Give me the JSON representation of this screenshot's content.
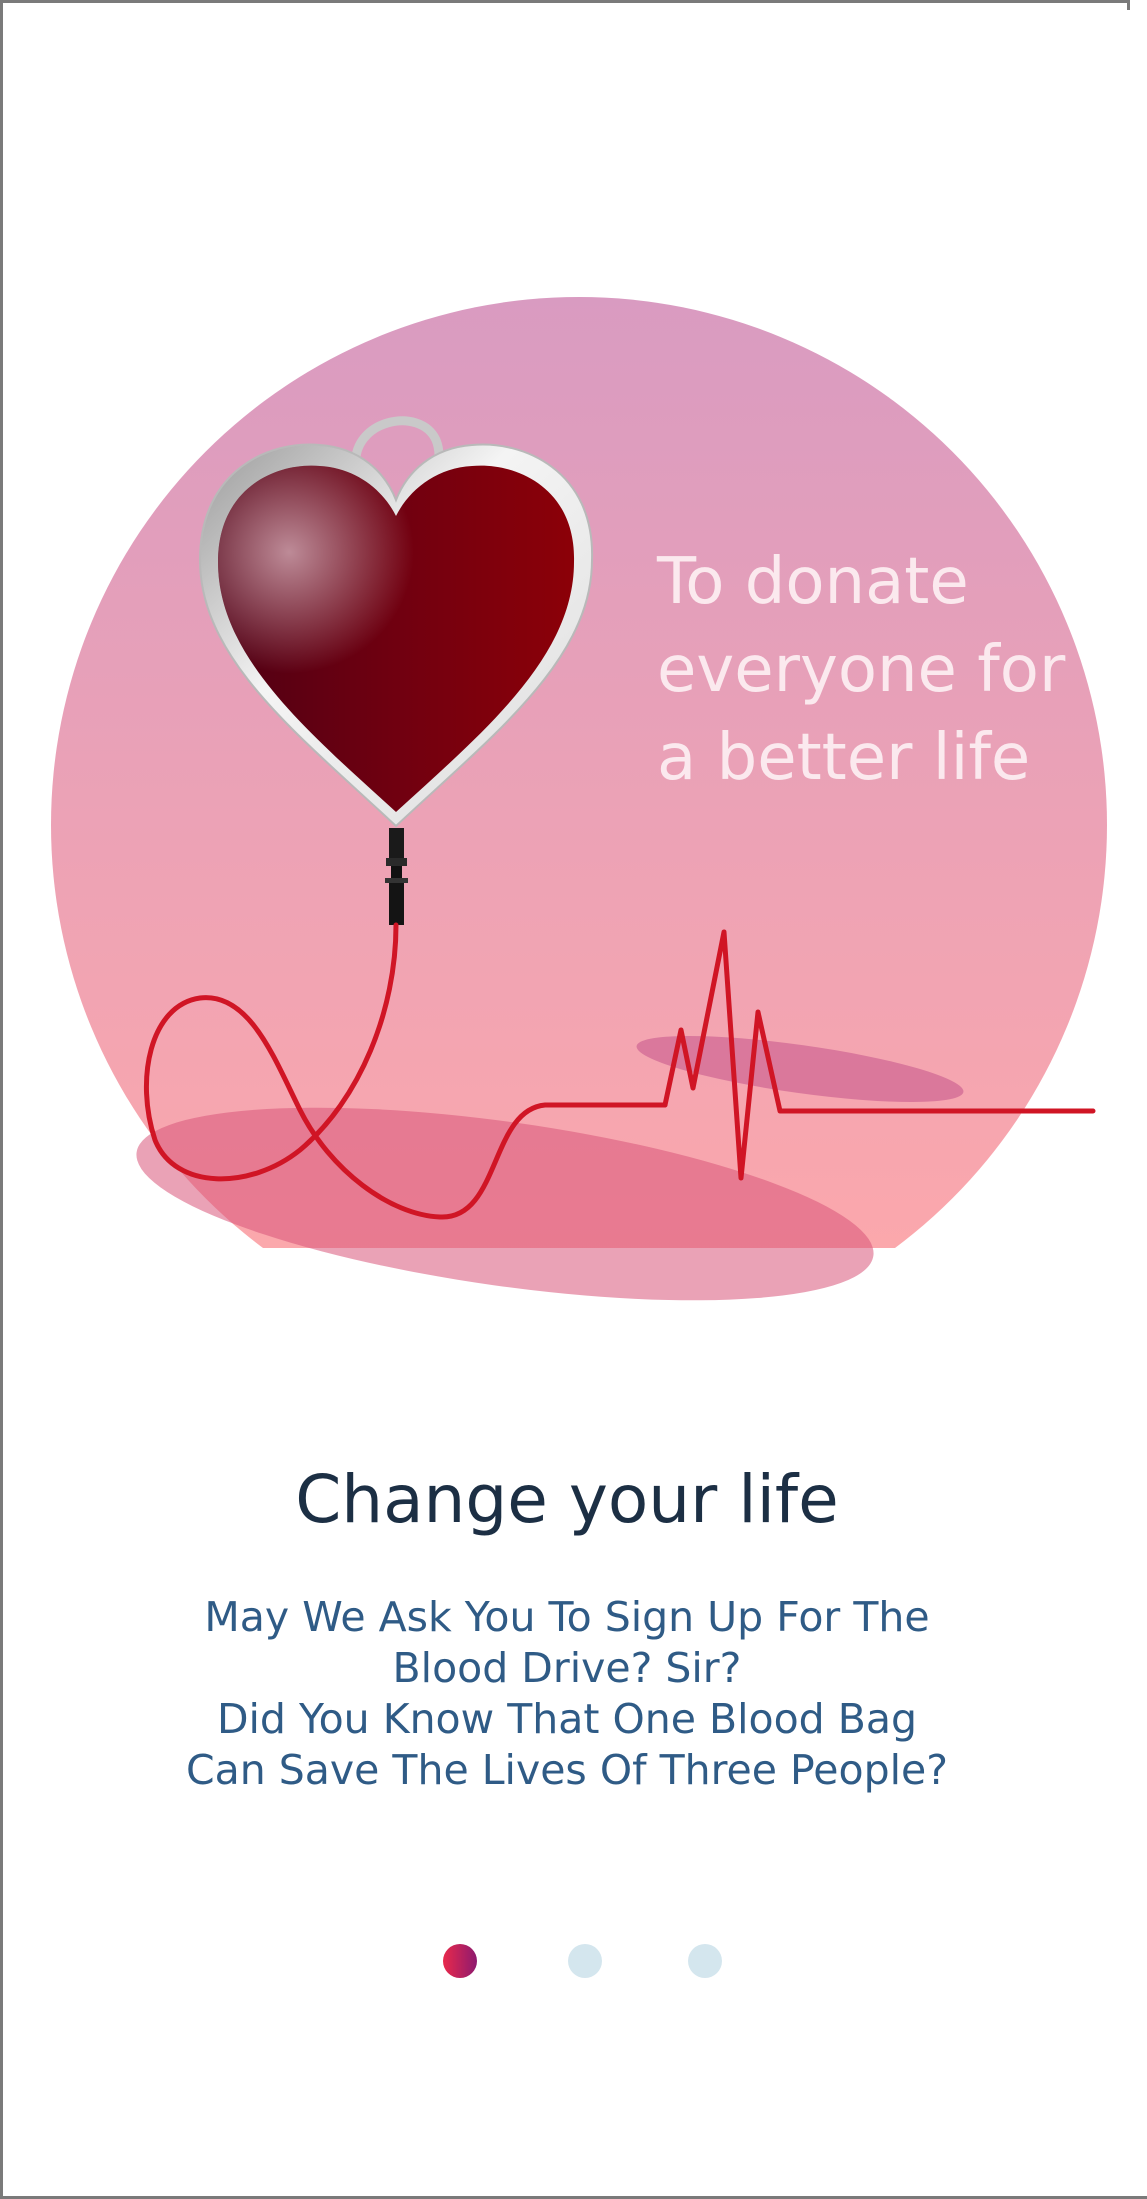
{
  "hero": {
    "tagline": "To donate everyone for a better life"
  },
  "content": {
    "title": "Change your life",
    "body": "May We Ask You To Sign Up For The\nBlood Drive? Sir?\nDid You Know That One Blood Bag\nCan Save The Lives Of Three People?"
  },
  "pagination": {
    "total": 3,
    "active_index": 0
  },
  "colors": {
    "circle_top": "#dc9cc0",
    "circle_bottom": "#ffaaaa",
    "heart": "#7a0010",
    "ecg_line": "#d01020",
    "title": "#1c2f44",
    "body": "#2f5b86",
    "dot_active_start": "#e8294b",
    "dot_active_end": "#8e1a6f",
    "dot_inactive": "#d4e6ee"
  },
  "icons": {
    "illustration": "heart-blood-bag-icon"
  }
}
